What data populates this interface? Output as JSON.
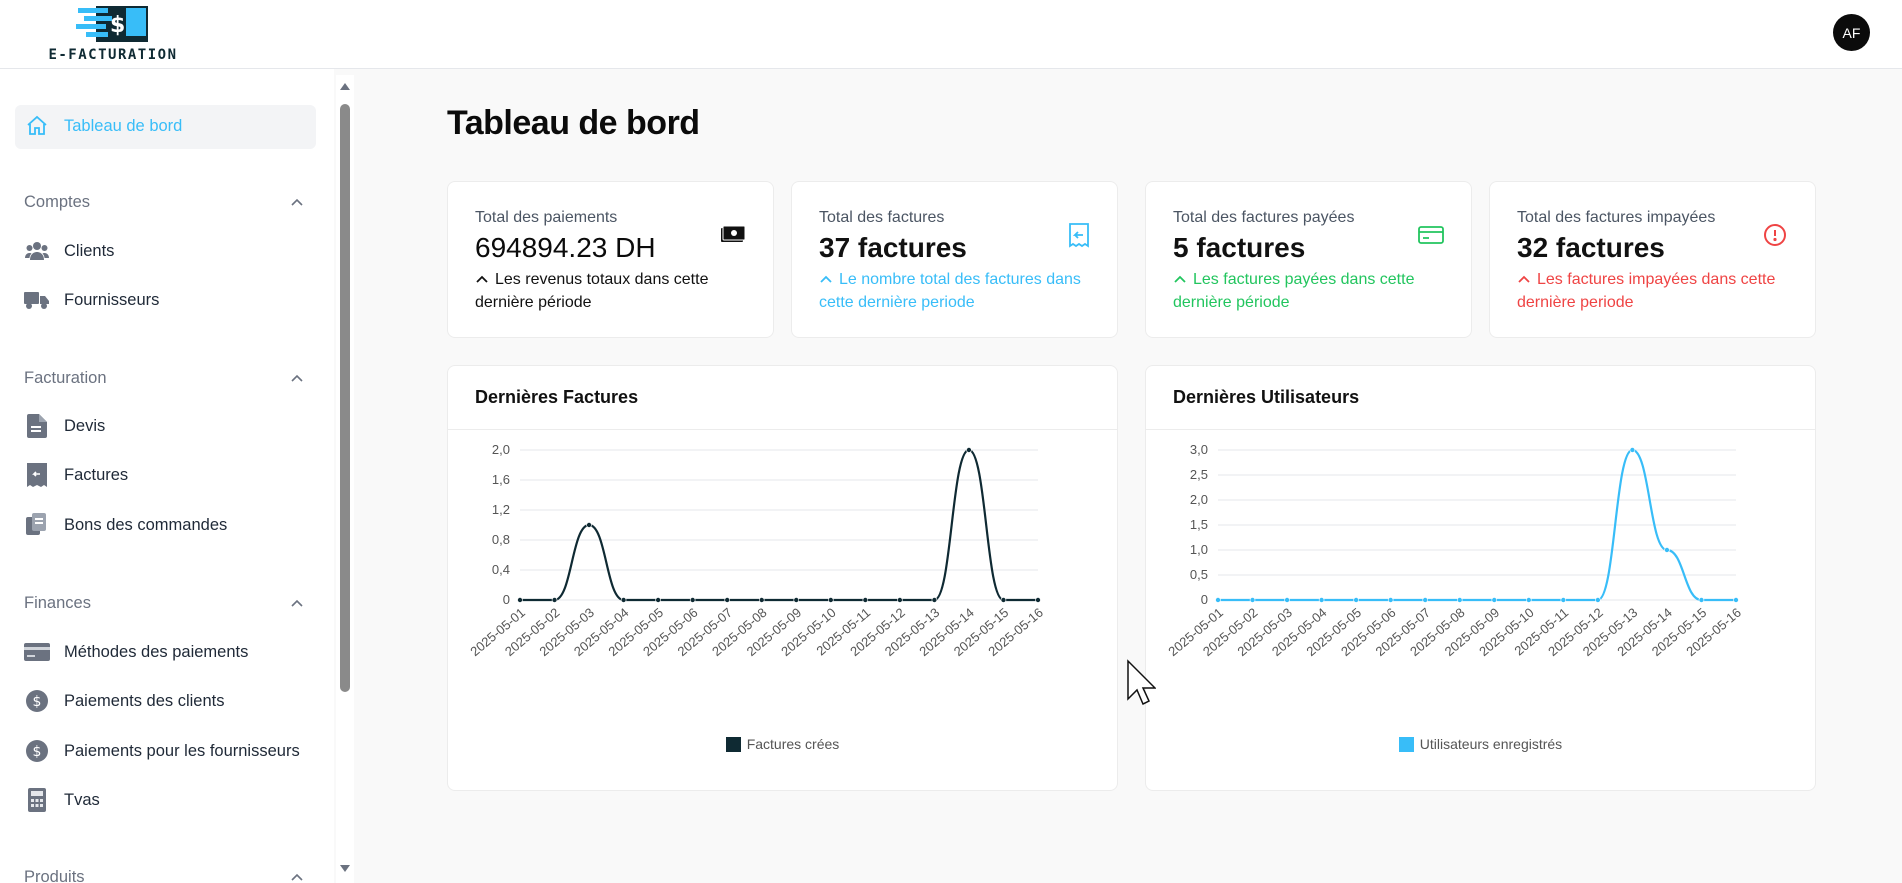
{
  "app": {
    "name": "E-FACTURATION",
    "avatar_initials": "AF"
  },
  "sidebar": {
    "active": {
      "label": "Tableau de bord",
      "icon": "home-icon"
    },
    "sections": [
      {
        "title": "Comptes",
        "items": [
          {
            "label": "Clients",
            "icon": "users-icon"
          },
          {
            "label": "Fournisseurs",
            "icon": "truck-icon"
          }
        ]
      },
      {
        "title": "Facturation",
        "items": [
          {
            "label": "Devis",
            "icon": "document-icon"
          },
          {
            "label": "Factures",
            "icon": "receipt-icon"
          },
          {
            "label": "Bons des commandes",
            "icon": "clipboard-icon"
          }
        ]
      },
      {
        "title": "Finances",
        "items": [
          {
            "label": "Méthodes des paiements",
            "icon": "credit-card-icon"
          },
          {
            "label": "Paiements des clients",
            "icon": "dollar-icon"
          },
          {
            "label": "Paiements pour les fournisseurs",
            "icon": "dollar-icon"
          },
          {
            "label": "Tvas",
            "icon": "calculator-icon"
          }
        ]
      },
      {
        "title": "Produits",
        "items": []
      }
    ]
  },
  "page": {
    "title": "Tableau de bord"
  },
  "stats": [
    {
      "label": "Total des paiements",
      "value": "694894.23 DH",
      "desc": "Les revenus totaux dans cette dernière période",
      "color": "#111111",
      "icon": "cash-icon"
    },
    {
      "label": "Total des factures",
      "value": "37 factures",
      "desc": "Le nombre total des factures dans cette dernière periode",
      "color": "#38bdf8",
      "icon": "receipt-icon"
    },
    {
      "label": "Total des factures payées",
      "value": "5 factures",
      "desc": "Les factures payées dans cette dernière période",
      "color": "#22c55e",
      "icon": "credit-card-icon"
    },
    {
      "label": "Total des factures impayées",
      "value": "32 factures",
      "desc": "Les factures impayées dans cette dernière periode",
      "color": "#ef4444",
      "icon": "alert-circle-icon"
    }
  ],
  "chart_data": [
    {
      "type": "line",
      "title": "Dernières Factures",
      "categories": [
        "2025-05-01",
        "2025-05-02",
        "2025-05-03",
        "2025-05-04",
        "2025-05-05",
        "2025-05-06",
        "2025-05-07",
        "2025-05-08",
        "2025-05-09",
        "2025-05-10",
        "2025-05-11",
        "2025-05-12",
        "2025-05-13",
        "2025-05-14",
        "2025-05-15",
        "2025-05-16"
      ],
      "series": [
        {
          "name": "Factures crées",
          "values": [
            0,
            0,
            1,
            0,
            0,
            0,
            0,
            0,
            0,
            0,
            0,
            0,
            0,
            2,
            0,
            0
          ],
          "color": "#0f2a33"
        }
      ],
      "yticks": [
        "0",
        "0,4",
        "0,8",
        "1,2",
        "1,6",
        "2,0"
      ],
      "ylim": [
        0,
        2
      ],
      "grid": true,
      "legend": "bottom"
    },
    {
      "type": "line",
      "title": "Dernières Utilisateurs",
      "categories": [
        "2025-05-01",
        "2025-05-02",
        "2025-05-03",
        "2025-05-04",
        "2025-05-05",
        "2025-05-06",
        "2025-05-07",
        "2025-05-08",
        "2025-05-09",
        "2025-05-10",
        "2025-05-11",
        "2025-05-12",
        "2025-05-13",
        "2025-05-14",
        "2025-05-15",
        "2025-05-16"
      ],
      "series": [
        {
          "name": "Utilisateurs enregistrés",
          "values": [
            0,
            0,
            0,
            0,
            0,
            0,
            0,
            0,
            0,
            0,
            0,
            0,
            3,
            1,
            0,
            0
          ],
          "color": "#38bdf8"
        }
      ],
      "yticks": [
        "0",
        "0,5",
        "1,0",
        "1,5",
        "2,0",
        "2,5",
        "3,0"
      ],
      "ylim": [
        0,
        3
      ],
      "grid": true,
      "legend": "bottom"
    }
  ]
}
